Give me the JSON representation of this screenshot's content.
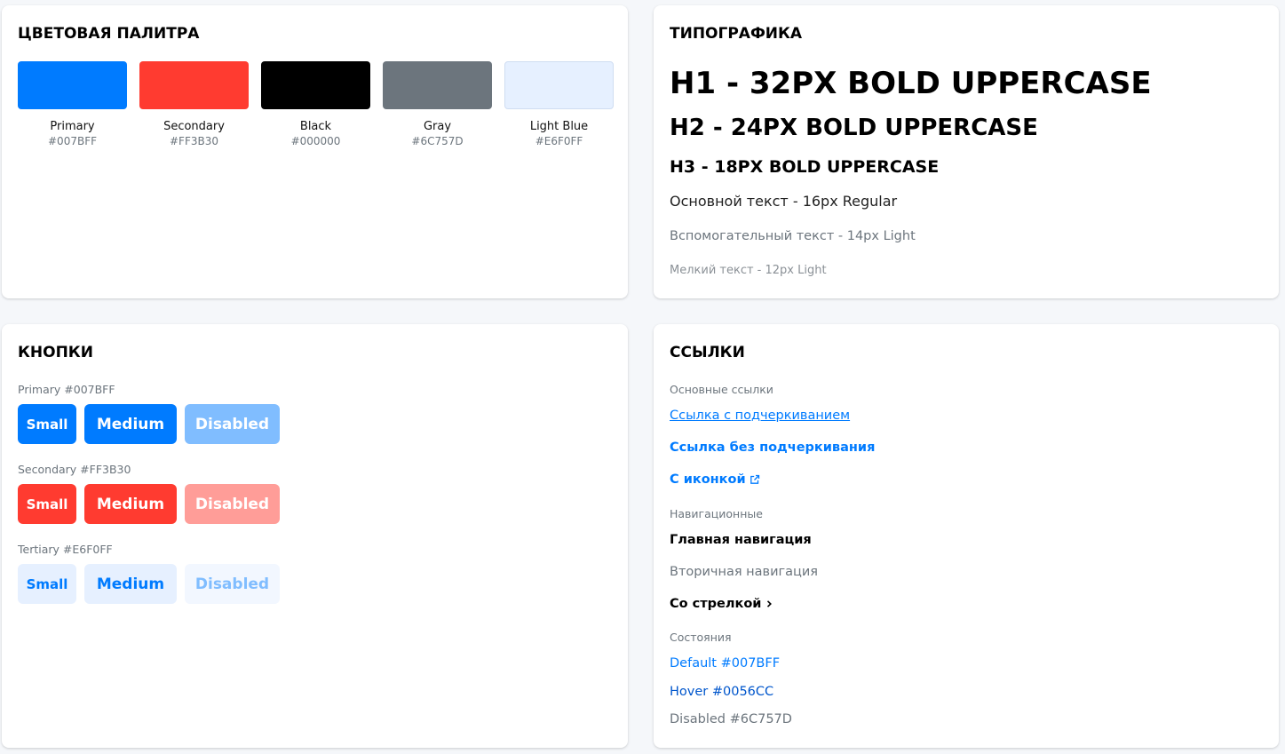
{
  "palette": {
    "title": "ЦВЕТОВАЯ ПАЛИТРА",
    "swatches": [
      {
        "name": "Primary",
        "hex": "#007BFF",
        "color": "#007BFF"
      },
      {
        "name": "Secondary",
        "hex": "#FF3B30",
        "color": "#FF3B30"
      },
      {
        "name": "Black",
        "hex": "#000000",
        "color": "#000000"
      },
      {
        "name": "Gray",
        "hex": "#6C757D",
        "color": "#6C757D"
      },
      {
        "name": "Light Blue",
        "hex": "#E6F0FF",
        "color": "#E6F0FF"
      }
    ]
  },
  "typography": {
    "title": "ТИПОГРАФИКА",
    "h1": "H1 - 32PX BOLD UPPERCASE",
    "h2": "H2 - 24PX BOLD UPPERCASE",
    "h3": "H3 - 18PX BOLD UPPERCASE",
    "body": "Основной текст - 16px Regular",
    "aux": "Вспомогательный текст - 14px Light",
    "small": "Мелкий текст - 12px Light"
  },
  "buttons": {
    "title": "КНОПКИ",
    "primary": {
      "label": "Primary #007BFF",
      "small": "Small",
      "medium": "Medium",
      "disabled": "Disabled"
    },
    "secondary": {
      "label": "Secondary #FF3B30",
      "small": "Small",
      "medium": "Medium",
      "disabled": "Disabled"
    },
    "tertiary": {
      "label": "Tertiary #E6F0FF",
      "small": "Small",
      "medium": "Medium",
      "disabled": "Disabled"
    }
  },
  "links": {
    "title": "ССЫЛКИ",
    "basic_label": "Основные ссылки",
    "underlined": "Ссылка с подчеркиванием",
    "no_underline": "Ссылка без подчеркивания",
    "with_icon": "С иконкой",
    "nav_label": "Навигационные",
    "nav_main": "Главная навигация",
    "nav_secondary": "Вторичная навигация",
    "with_arrow": "Со стрелкой",
    "states_label": "Состояния",
    "state_default": "Default #007BFF",
    "state_hover": "Hover #0056CC",
    "state_disabled": "Disabled #6C757D"
  }
}
